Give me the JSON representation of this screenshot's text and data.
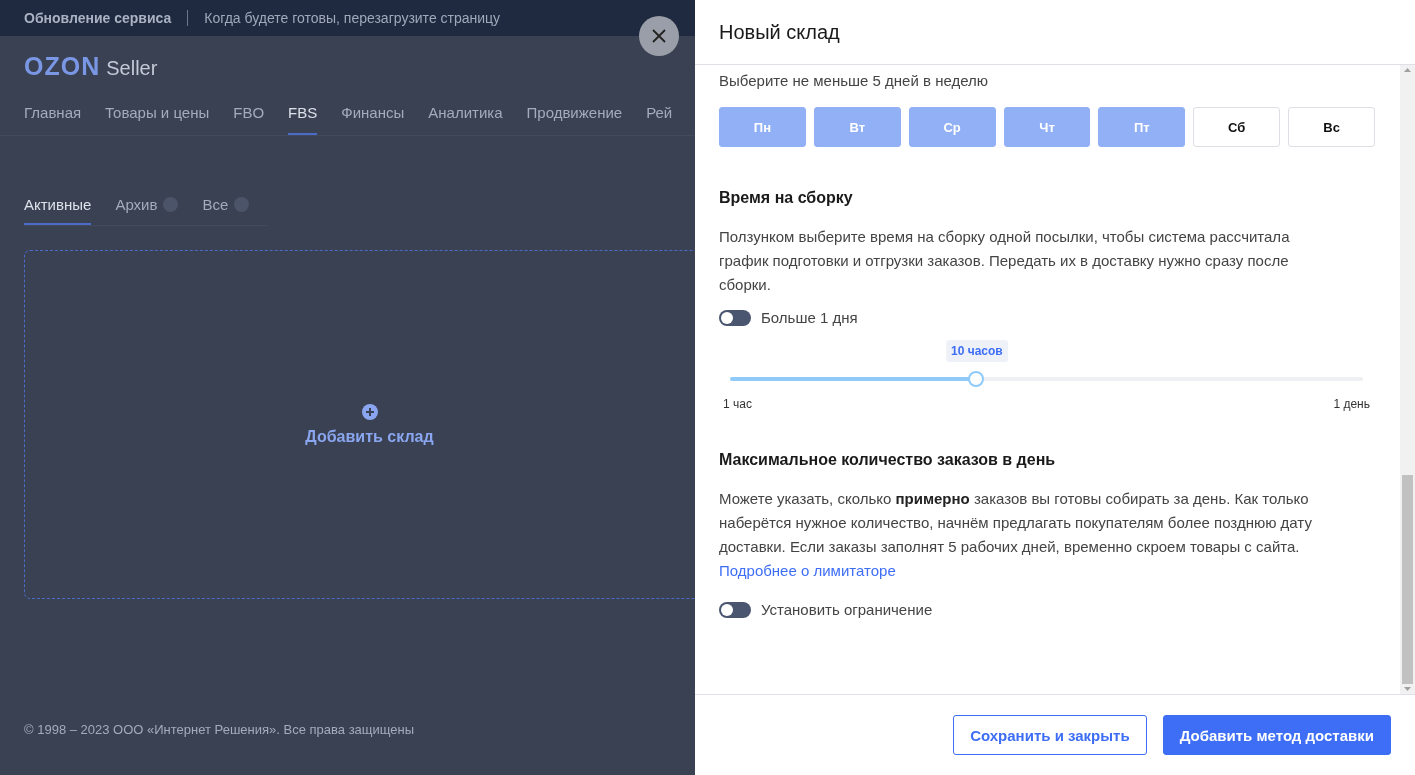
{
  "banner": {
    "title": "Обновление сервиса",
    "message": "Когда будете готовы, перезагрузите страницу"
  },
  "logo": {
    "brand": "OZON",
    "product": "Seller"
  },
  "nav": [
    {
      "label": "Главная",
      "selected": false
    },
    {
      "label": "Товары и цены",
      "selected": false
    },
    {
      "label": "FBO",
      "selected": false
    },
    {
      "label": "FBS",
      "selected": true
    },
    {
      "label": "Финансы",
      "selected": false
    },
    {
      "label": "Аналитика",
      "selected": false
    },
    {
      "label": "Продвижение",
      "selected": false
    },
    {
      "label": "Рей",
      "selected": false
    }
  ],
  "tabs": [
    {
      "label": "Активные",
      "selected": true,
      "has_counter": false
    },
    {
      "label": "Архив",
      "selected": false,
      "has_counter": true
    },
    {
      "label": "Все",
      "selected": false,
      "has_counter": true
    }
  ],
  "add_card": {
    "label": "Добавить склад"
  },
  "footer": {
    "copyright": "© 1998 – 2023 ООО «Интернет Решения». Все права защищены"
  },
  "drawer": {
    "title": "Новый склад",
    "days_hint": "Выберите не меньше 5 дней в неделю",
    "days": [
      {
        "label": "Пн",
        "selected": true
      },
      {
        "label": "Вт",
        "selected": true
      },
      {
        "label": "Ср",
        "selected": true
      },
      {
        "label": "Чт",
        "selected": true
      },
      {
        "label": "Пт",
        "selected": true
      },
      {
        "label": "Сб",
        "selected": false
      },
      {
        "label": "Вс",
        "selected": false
      }
    ],
    "assembly": {
      "heading": "Время на сборку",
      "text": "Ползунком выберите время на сборку одной посылки, чтобы система рассчитала график подготовки и отгрузки заказов. Передать их в доставку нужно сразу после сборки.",
      "toggle": {
        "label": "Больше 1 дня",
        "on": false
      },
      "slider": {
        "value_label": "10 часов",
        "level": 0.39,
        "min_label": "1 час",
        "max_label": "1 день"
      }
    },
    "limit": {
      "heading": "Максимальное количество заказов в день",
      "text": "Можете указать, сколько **примерно** заказов вы готовы собирать за день. Как только наберётся нужное количество, начнём предлагать покупателям более позднюю дату доставки. Если заказы заполнят 5 рабочих дней, временно скроем товары с сайта.",
      "link": "Подробнее о лимитаторе",
      "toggle": {
        "label": "Установить ограничение",
        "on": false
      }
    },
    "buttons": [
      {
        "label": "Сохранить и закрыть",
        "kind": "secondary"
      },
      {
        "label": "Добавить метод доставки",
        "kind": "primary"
      }
    ]
  }
}
